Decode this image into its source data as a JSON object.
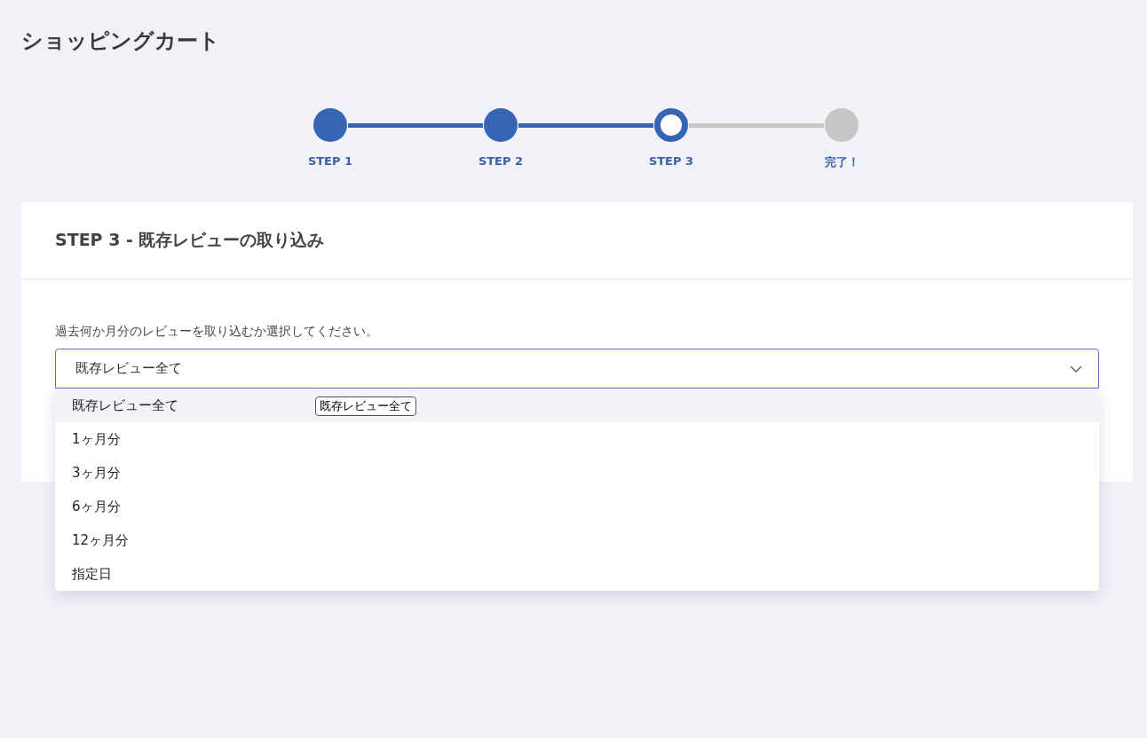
{
  "page_title": "ショッピングカート",
  "steps": [
    {
      "label": "STEP 1",
      "kind": "done"
    },
    {
      "label": "STEP 2",
      "kind": "done"
    },
    {
      "label": "STEP 3",
      "kind": "current"
    },
    {
      "label": "完了！",
      "kind": "todo"
    }
  ],
  "card": {
    "title": "STEP 3 - 既存レビューの取り込み",
    "prompt": "過去何か月分のレビューを取り込むか選択してください。",
    "select": {
      "value": "既存レビュー全て",
      "expanded": true,
      "options": [
        {
          "label": "既存レビュー全て",
          "selected": true
        },
        {
          "label": "1ヶ月分",
          "selected": false
        },
        {
          "label": "3ヶ月分",
          "selected": false
        },
        {
          "label": "6ヶ月分",
          "selected": false
        },
        {
          "label": "12ヶ月分",
          "selected": false
        },
        {
          "label": "指定日",
          "selected": false
        }
      ],
      "tooltip": "既存レビュー全て"
    }
  }
}
